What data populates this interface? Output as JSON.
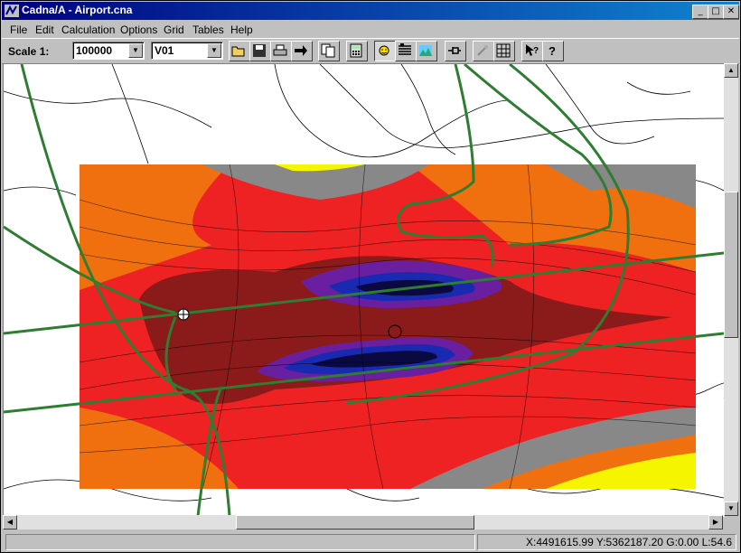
{
  "window": {
    "title": "Cadna/A - Airport.cna"
  },
  "title_buttons": {
    "minimize": "_",
    "maximize": "□",
    "close": "✕"
  },
  "menu": [
    "File",
    "Edit",
    "Calculation",
    "Options",
    "Grid",
    "Tables",
    "Help"
  ],
  "toolbar": {
    "scale_label": "Scale 1:",
    "scale_value": "100000",
    "variant_value": "V01",
    "buttons": [
      "open-folder-icon",
      "save-disk-icon",
      "print-icon",
      "arrow-right-icon",
      "copy-icon",
      "calculator-icon",
      "sun-icon",
      "list-table-icon",
      "landscape-icon",
      "pin-icon",
      "magic-wand-icon",
      "grid-image-icon",
      "help-pointer-icon",
      "help-icon"
    ]
  },
  "map": {
    "colors": {
      "background": "#ffffff",
      "noise_red": "#ee2222",
      "noise_darkred": "#8b1a1a",
      "noise_orange": "#f07010",
      "noise_gray": "#888888",
      "noise_yellow": "#f5f500",
      "noise_purple": "#6a1fa0",
      "noise_blue": "#1a2ab0",
      "noise_navy": "#0a0a40",
      "road_green": "#2e7d32"
    }
  },
  "status": {
    "coords": "X:4491615.99 Y:5362187.20 G:0.00 L:54.6"
  }
}
